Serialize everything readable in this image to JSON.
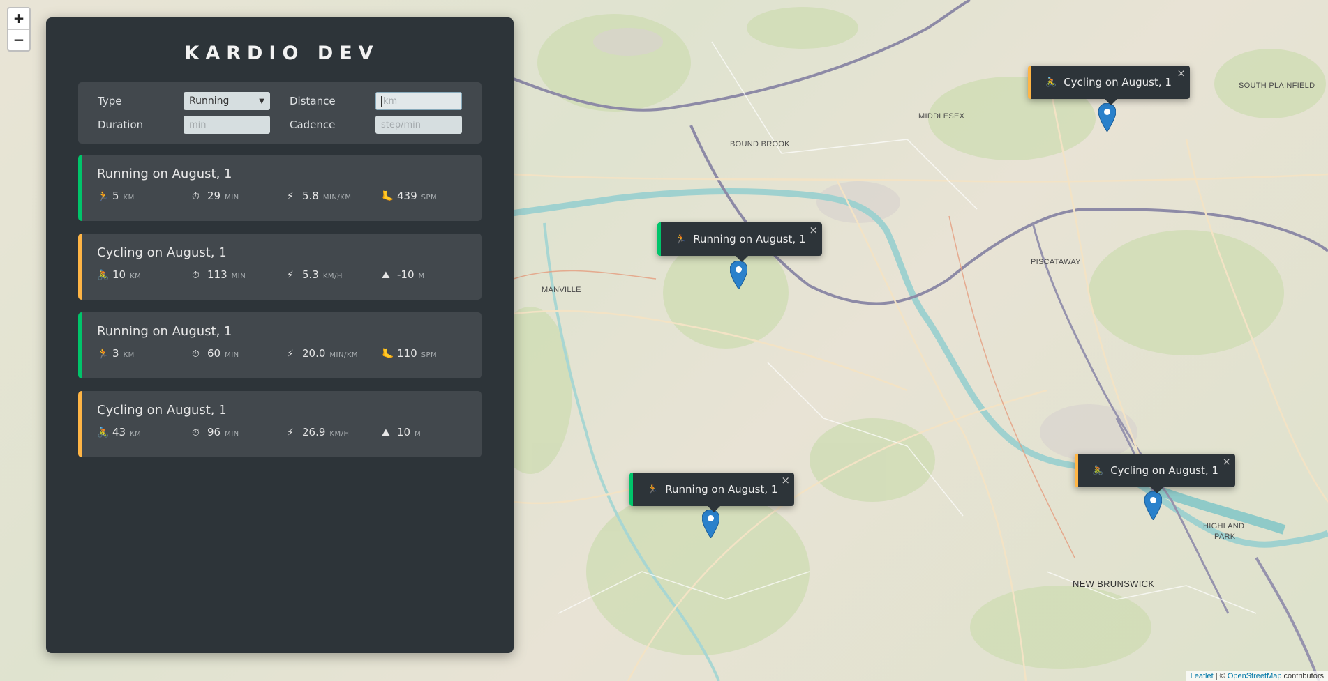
{
  "sidebar": {
    "logo": "KARDIO DEV",
    "form": {
      "type_label": "Type",
      "type_value": "Running",
      "distance_label": "Distance",
      "distance_placeholder": "km",
      "duration_label": "Duration",
      "duration_placeholder": "min",
      "cadence_label": "Cadence",
      "cadence_placeholder": "step/min"
    },
    "workouts": [
      {
        "type": "running",
        "title": "Running on August, 1",
        "stats": [
          {
            "icon": "🏃",
            "icon_name": "runner-icon",
            "value": "5",
            "unit": "km"
          },
          {
            "icon": "⏱",
            "icon_name": "stopwatch-icon",
            "value": "29",
            "unit": "min"
          },
          {
            "icon": "⚡",
            "icon_name": "lightning-icon",
            "value": "5.8",
            "unit": "min/km"
          },
          {
            "icon": "🦶",
            "icon_name": "footprint-icon",
            "value": "439",
            "unit": "spm"
          }
        ]
      },
      {
        "type": "cycling",
        "title": "Cycling on August, 1",
        "stats": [
          {
            "icon": "🚴",
            "icon_name": "cyclist-icon",
            "value": "10",
            "unit": "km"
          },
          {
            "icon": "⏱",
            "icon_name": "stopwatch-icon",
            "value": "113",
            "unit": "min"
          },
          {
            "icon": "⚡",
            "icon_name": "lightning-icon",
            "value": "5.3",
            "unit": "km/h"
          },
          {
            "icon": "⛰",
            "icon_name": "mountain-icon",
            "value": "-10",
            "unit": "m"
          }
        ]
      },
      {
        "type": "running",
        "title": "Running on August, 1",
        "stats": [
          {
            "icon": "🏃",
            "icon_name": "runner-icon",
            "value": "3",
            "unit": "km"
          },
          {
            "icon": "⏱",
            "icon_name": "stopwatch-icon",
            "value": "60",
            "unit": "min"
          },
          {
            "icon": "⚡",
            "icon_name": "lightning-icon",
            "value": "20.0",
            "unit": "min/km"
          },
          {
            "icon": "🦶",
            "icon_name": "footprint-icon",
            "value": "110",
            "unit": "spm"
          }
        ]
      },
      {
        "type": "cycling",
        "title": "Cycling on August, 1",
        "stats": [
          {
            "icon": "🚴",
            "icon_name": "cyclist-icon",
            "value": "43",
            "unit": "km"
          },
          {
            "icon": "⏱",
            "icon_name": "stopwatch-icon",
            "value": "96",
            "unit": "min"
          },
          {
            "icon": "⚡",
            "icon_name": "lightning-icon",
            "value": "26.9",
            "unit": "km/h"
          },
          {
            "icon": "⛰",
            "icon_name": "mountain-icon",
            "value": "10",
            "unit": "m"
          }
        ]
      }
    ]
  },
  "map": {
    "zoom_in": "+",
    "zoom_out": "−",
    "labels": [
      "MIDDLESEX",
      "SOUTH PLAINFIELD",
      "BOUND BROOK",
      "PISCATAWAY",
      "MANVILLE",
      "HIGHLAND",
      "PARK",
      "NEW BRUNSWICK"
    ],
    "popups": [
      {
        "type": "cycling",
        "icon": "🚴",
        "text": "Cycling on August, 1",
        "close": "×"
      },
      {
        "type": "running",
        "icon": "🏃",
        "text": "Running on August, 1",
        "close": "×"
      },
      {
        "type": "running",
        "icon": "🏃",
        "text": "Running on August, 1",
        "close": "×"
      },
      {
        "type": "cycling",
        "icon": "🚴",
        "text": "Cycling on August, 1",
        "close": "×"
      }
    ],
    "attribution": {
      "leaflet": "Leaflet",
      "separator": " | © ",
      "osm": "OpenStreetMap",
      "suffix": " contributors"
    }
  },
  "colors": {
    "running": "#00c46a",
    "cycling": "#ffb545",
    "panel": "#2d3439",
    "card": "#42484d",
    "marker": "#2a81cb"
  }
}
